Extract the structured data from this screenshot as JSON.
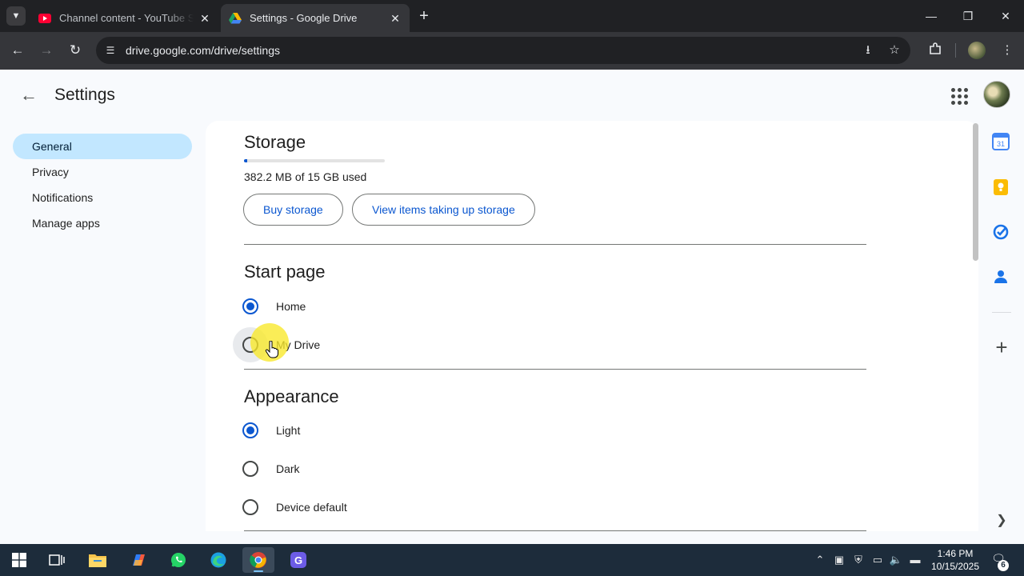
{
  "browser": {
    "tabs": [
      {
        "title": "Channel content - YouTube Studio",
        "favicon": "youtube-icon",
        "active": false
      },
      {
        "title": "Settings - Google Drive",
        "favicon": "google-drive-icon",
        "active": true
      }
    ],
    "url": "drive.google.com/drive/settings"
  },
  "page": {
    "title": "Settings",
    "nav": [
      {
        "label": "General",
        "selected": true
      },
      {
        "label": "Privacy",
        "selected": false
      },
      {
        "label": "Notifications",
        "selected": false
      },
      {
        "label": "Manage apps",
        "selected": false
      }
    ]
  },
  "storage": {
    "heading": "Storage",
    "used_text": "382.2 MB of 15 GB used",
    "used_fraction": 0.025,
    "buy_button": "Buy storage",
    "view_button": "View items taking up storage"
  },
  "start_page": {
    "heading": "Start page",
    "options": [
      {
        "label": "Home",
        "checked": true
      },
      {
        "label": "My Drive",
        "checked": false
      }
    ]
  },
  "appearance": {
    "heading": "Appearance",
    "options": [
      {
        "label": "Light",
        "checked": true
      },
      {
        "label": "Dark",
        "checked": false
      },
      {
        "label": "Device default",
        "checked": false
      }
    ]
  },
  "side_panel": {
    "icons": [
      "calendar-icon",
      "keep-icon",
      "tasks-icon",
      "contacts-icon",
      "add-icon",
      "chevron-right-icon"
    ],
    "calendar_day": "31"
  },
  "taskbar": {
    "time": "1:46 PM",
    "date": "10/15/2025",
    "notification_count": "6",
    "apps": [
      "start-icon",
      "task-view-icon",
      "file-explorer-icon",
      "copilot-icon",
      "whatsapp-icon",
      "edge-icon",
      "chrome-icon",
      "app-icon"
    ]
  },
  "colors": {
    "accent": "#0b57d0",
    "selected_nav": "#c2e7ff",
    "cursor_highlight": "#f8e828"
  }
}
